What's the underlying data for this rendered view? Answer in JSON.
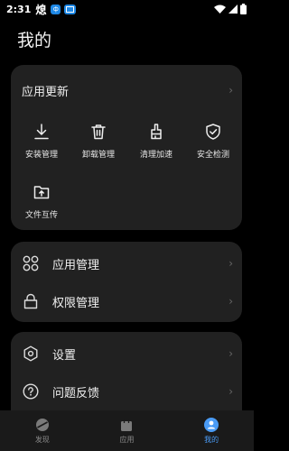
{
  "status_bar": {
    "time": "2:31",
    "app_glyph": "熄",
    "badge_text": "ф",
    "icons": [
      "wifi-icon",
      "signal-icon",
      "battery-icon"
    ]
  },
  "page": {
    "title": "我的"
  },
  "updates_card": {
    "header_label": "应用更新",
    "tools": [
      {
        "label": "安装管理",
        "icon": "download-icon"
      },
      {
        "label": "卸载管理",
        "icon": "trash-icon"
      },
      {
        "label": "清理加速",
        "icon": "broom-icon"
      },
      {
        "label": "安全检测",
        "icon": "shield-check-icon"
      },
      {
        "label": "文件互传",
        "icon": "folder-upload-icon"
      }
    ]
  },
  "manage_card": {
    "items": [
      {
        "label": "应用管理",
        "icon": "apps-grid-icon"
      },
      {
        "label": "权限管理",
        "icon": "lock-icon"
      }
    ]
  },
  "settings_card": {
    "items": [
      {
        "label": "设置",
        "icon": "gear-icon"
      },
      {
        "label": "问题反馈",
        "icon": "help-icon"
      }
    ]
  },
  "tabbar": {
    "tabs": [
      {
        "label": "发现",
        "icon": "planet-icon",
        "active": false
      },
      {
        "label": "应用",
        "icon": "bag-icon",
        "active": false
      },
      {
        "label": "我的",
        "icon": "user-icon",
        "active": true
      }
    ],
    "accent": "#4a9bf5"
  },
  "colors": {
    "background": "#000000",
    "card": "#212121",
    "accent": "#4a9bf5"
  }
}
